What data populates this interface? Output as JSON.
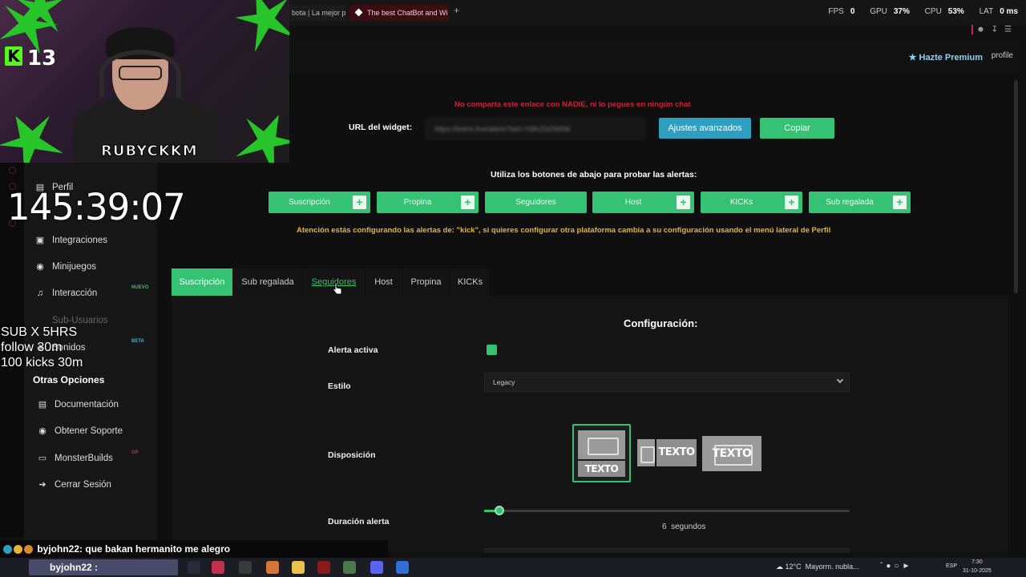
{
  "browser": {
    "tabs": [
      {
        "label": "bota | La mejor pl"
      },
      {
        "label": "The best ChatBot and Wi"
      }
    ],
    "new_tab": "+",
    "stats": {
      "fps_label": "FPS",
      "fps_value": "0",
      "gpu_label": "GPU",
      "gpu_value": "37%",
      "cpu_label": "CPU",
      "cpu_value": "53%",
      "lat_label": "LAT",
      "lat_value": "0 ms"
    }
  },
  "header": {
    "premium": "Hazte Premium",
    "profile": "profile"
  },
  "sidebar": {
    "items": [
      {
        "label": "Perfil",
        "icon": "id-card-icon"
      },
      {
        "label": "Integraciones",
        "icon": "window-icon"
      },
      {
        "label": "Minijuegos",
        "icon": "gamepad-icon"
      },
      {
        "label": "Interacción",
        "icon": "music-note-icon",
        "badge": "NUEVO"
      },
      {
        "label": "Sub-Usuarios",
        "icon": "users-icon"
      },
      {
        "label": "Sonidos",
        "icon": "sound-icon",
        "badge": "BETA"
      }
    ],
    "section_title": "Otras Opciones",
    "other_items": [
      {
        "label": "Documentación",
        "icon": "book-icon"
      },
      {
        "label": "Obtener Soporte",
        "icon": "support-icon"
      },
      {
        "label": "MonsterBuilds",
        "icon": "laptop-icon",
        "badge": "GP"
      },
      {
        "label": "Cerrar Sesión",
        "icon": "logout-icon"
      }
    ]
  },
  "widget": {
    "warning": "No comparta este enlace con NADIE, ni lo pegues en ningún chat",
    "url_label": "URL del widget:",
    "url_value": "https://botrix.live/alerts?bid=YMhJSrDWNk",
    "advanced_button": "Ajustes avanzados",
    "copy_button": "Copiar",
    "test_hint": "Utiliza los botones de abajo para probar las alertas:",
    "test_buttons": [
      {
        "label": "Suscripción",
        "plus": true
      },
      {
        "label": "Propina",
        "plus": true
      },
      {
        "label": "Seguidores",
        "plus": false
      },
      {
        "label": "Host",
        "plus": true
      },
      {
        "label": "KICKs",
        "plus": true
      },
      {
        "label": "Sub regalada",
        "plus": true
      }
    ],
    "platform_notice": "Atención estás configurando las alertas de: \"kick\", si quieres configurar otra plataforma cambia a su configuración usando el menú lateral de Perfil"
  },
  "alert_tabs": [
    "Suscripción",
    "Sub regalada",
    "Seguidores",
    "Host",
    "Propina",
    "KICKs"
  ],
  "alert_tabs_active": "Suscripción",
  "config": {
    "title": "Configuración:",
    "active_label": "Alerta activa",
    "active_value": true,
    "style_label": "Estilo",
    "style_value": "Legacy",
    "layout_label": "Disposición",
    "layout_text": "TEXTO",
    "duration_label": "Duración alerta",
    "duration_value": 6,
    "duration_unit": "segundos"
  },
  "overlay": {
    "kick_count": "13",
    "streamer_name": "RUBYCKKM",
    "timer": "145:39:07",
    "goals": [
      "SUB X 5HRS",
      "follow 30m",
      "100 kicks 30m"
    ],
    "chat": {
      "user": "byjohn22",
      "message": ": que bakan hermanito me alegro"
    }
  },
  "taskbar": {
    "user": "byjohn22 :",
    "weather": "12°C",
    "weather_desc": "Mayorm. nubla...",
    "lang": "ESP",
    "time": "7:30",
    "date": "31-10-2025"
  },
  "colors": {
    "accent_green": "#35c274",
    "accent_blue": "#2f9fc1",
    "warning_red": "#c8223a",
    "notice_yellow": "#e9b336"
  }
}
